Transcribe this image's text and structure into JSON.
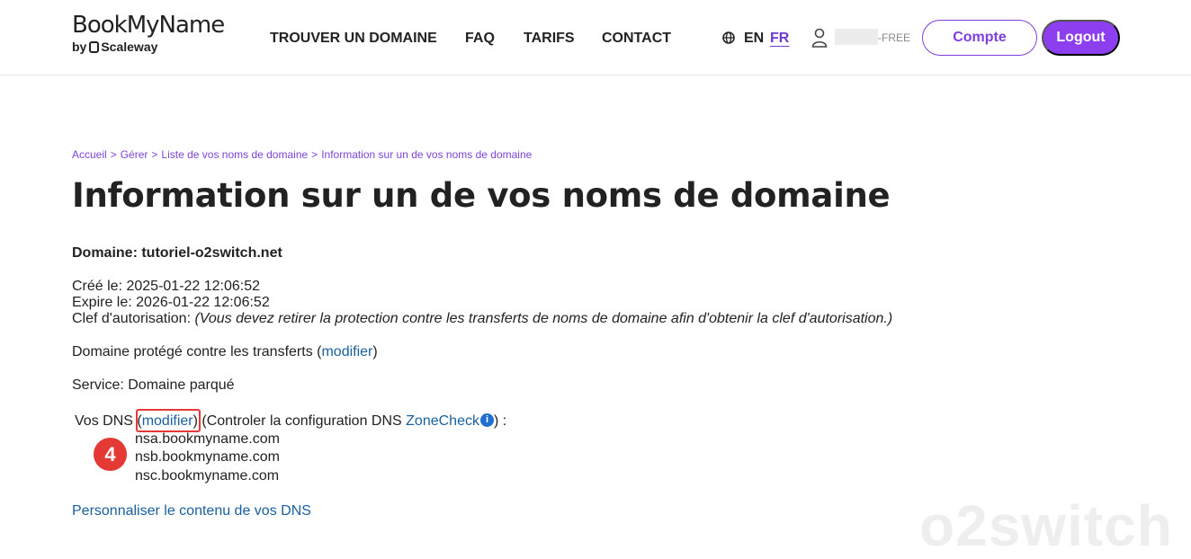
{
  "header": {
    "logo_name": "BookMyName",
    "logo_by": "by",
    "logo_partner": "Scaleway",
    "nav": [
      "TROUVER UN DOMAINE",
      "FAQ",
      "TARIFS",
      "CONTACT"
    ],
    "lang_en": "EN",
    "lang_fr": "FR",
    "user_suffix": "-FREE",
    "compte_label": "Compte",
    "logout_label": "Logout"
  },
  "breadcrumb": [
    "Accueil",
    "Gérer",
    "Liste de vos noms de domaine",
    "Information sur un de vos noms de domaine"
  ],
  "breadcrumb_sep": ">",
  "page_title": "Information sur un de vos noms de domaine",
  "domain": {
    "label": "Domaine: tutoriel-o2switch.net",
    "created": "Créé le: 2025-01-22 12:06:52",
    "expires": "Expire le: 2026-01-22 12:06:52",
    "auth_label": "Clef d'autorisation:",
    "auth_note": "(Vous devez retirer la protection contre les transferts de noms de domaine afin d'obtenir la clef d'autorisation.)",
    "protection_text": "Domaine protégé contre les transferts (",
    "protection_link": "modifier",
    "protection_close": ")",
    "service": "Service: Domaine parqué"
  },
  "dns": {
    "label": "Vos DNS (",
    "modify_link": "modifier",
    "check_text": ") (Controler la configuration DNS ",
    "zonecheck_link": "ZoneCheck",
    "info_glyph": "i",
    "check_close": ") :",
    "servers": [
      "nsa.bookmyname.com",
      "nsb.bookmyname.com",
      "nsc.bookmyname.com"
    ],
    "customize_link": "Personnaliser le contenu de vos DNS"
  },
  "annotation": {
    "step": "4"
  },
  "watermark": "o2switch",
  "colors": {
    "accent": "#8d3ff0",
    "link": "#1a5f9e",
    "highlight": "#e53935"
  }
}
